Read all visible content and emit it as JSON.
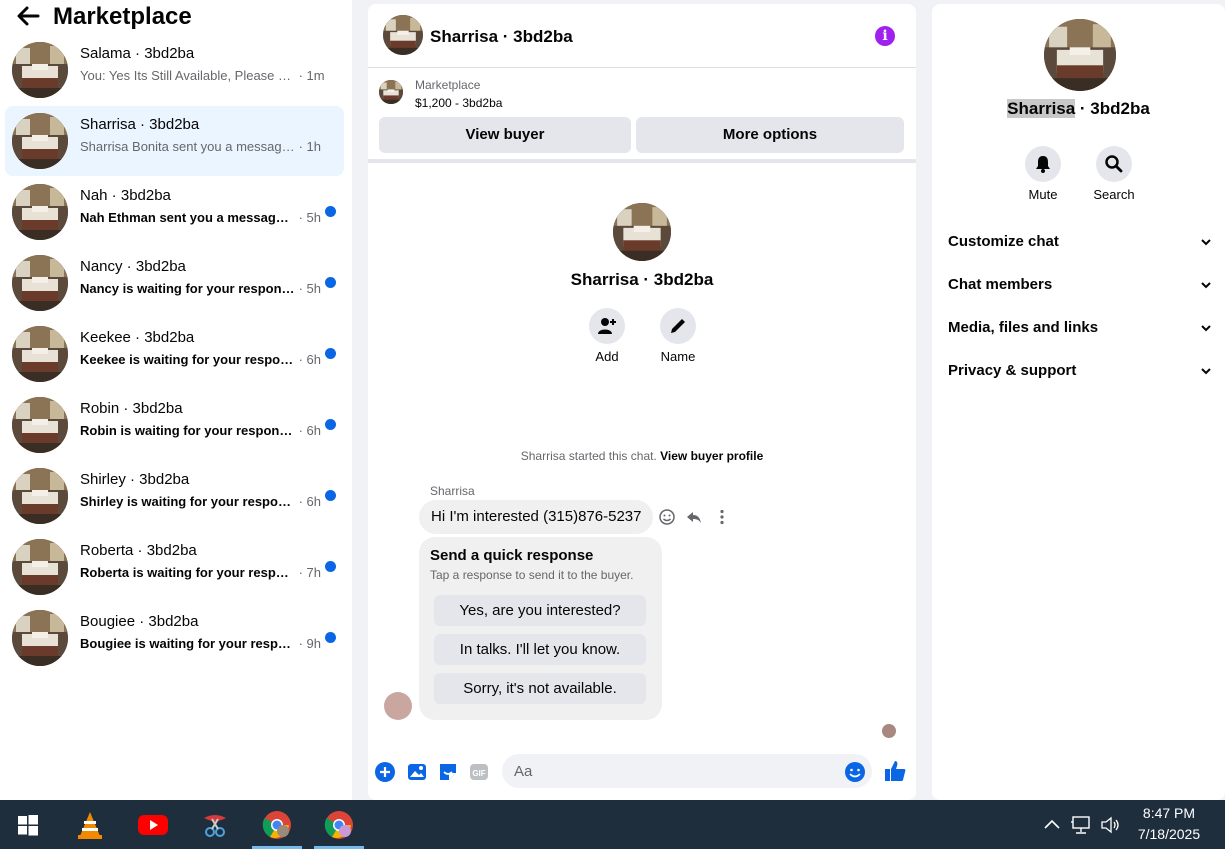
{
  "sidebar": {
    "title": "Marketplace",
    "conversations": [
      {
        "name": "Salama · 3bd2ba",
        "message": "You: Yes Its Still Available, Please Sen...",
        "time": " · 1m",
        "unread": false
      },
      {
        "name": "Sharrisa · 3bd2ba",
        "message": "Sharrisa Bonita sent you a message a...",
        "time": " · 1h",
        "unread": false
      },
      {
        "name": "Nah · 3bd2ba",
        "message": "Nah Ethman sent you a message a...",
        "time": " · 5h",
        "unread": true
      },
      {
        "name": "Nancy · 3bd2ba",
        "message": "Nancy is waiting for your response.",
        "time": " · 5h",
        "unread": true
      },
      {
        "name": "Keekee · 3bd2ba",
        "message": "Keekee is waiting for your response.",
        "time": " · 6h",
        "unread": true
      },
      {
        "name": "Robin · 3bd2ba",
        "message": "Robin is waiting for your response.",
        "time": " · 6h",
        "unread": true
      },
      {
        "name": "Shirley · 3bd2ba",
        "message": "Shirley is waiting for your response.",
        "time": " · 6h",
        "unread": true
      },
      {
        "name": "Roberta · 3bd2ba",
        "message": "Roberta is waiting for your respon...",
        "time": " · 7h",
        "unread": true
      },
      {
        "name": "Bougiee · 3bd2ba",
        "message": "Bougiee is waiting for your respon...",
        "time": " · 9h",
        "unread": true
      }
    ]
  },
  "chat": {
    "title": "Sharrisa · 3bd2ba",
    "listing_label": "Marketplace",
    "listing_price": "$1,200 - 3bd2ba",
    "view_buyer": "View buyer",
    "more_options": "More options",
    "center_name": "Sharrisa · 3bd2ba",
    "add_label": "Add",
    "name_label": "Name",
    "started_text": "Sharrisa started this chat. ",
    "started_link": "View buyer profile",
    "sender": "Sharrisa",
    "message": "Hi I'm interested (315)876-5237",
    "quick_title": "Send a quick response",
    "quick_sub": "Tap a response to send it to the buyer.",
    "quick_responses": [
      "Yes, are you interested?",
      "In talks. I'll let you know.",
      "Sorry, it's not available."
    ],
    "composer_placeholder": "Aa"
  },
  "details": {
    "name_highlight": "Sharrisa",
    "name_rest": " · 3bd2ba",
    "mute_label": "Mute",
    "search_label": "Search",
    "sections": [
      "Customize chat",
      "Chat members",
      "Media, files and links",
      "Privacy & support"
    ]
  },
  "taskbar": {
    "time": "8:47 PM",
    "date": "7/18/2025"
  },
  "colors": {
    "accent": "#0a66e4",
    "info": "#a020f0",
    "active_row": "#ebf5ff"
  },
  "icons": [
    "back-arrow-icon",
    "info-icon",
    "add-person-icon",
    "pencil-icon",
    "emoji-icon",
    "reply-icon",
    "more-vertical-icon",
    "plus-icon",
    "image-icon",
    "sticker-icon",
    "gif-icon",
    "smiley-icon",
    "like-icon",
    "bell-icon",
    "search-icon",
    "chevron-down-icon",
    "windows-start-icon",
    "vlc-icon",
    "youtube-icon",
    "snipping-tool-icon",
    "chrome-icon",
    "chevron-up-icon",
    "network-icon",
    "volume-icon"
  ]
}
